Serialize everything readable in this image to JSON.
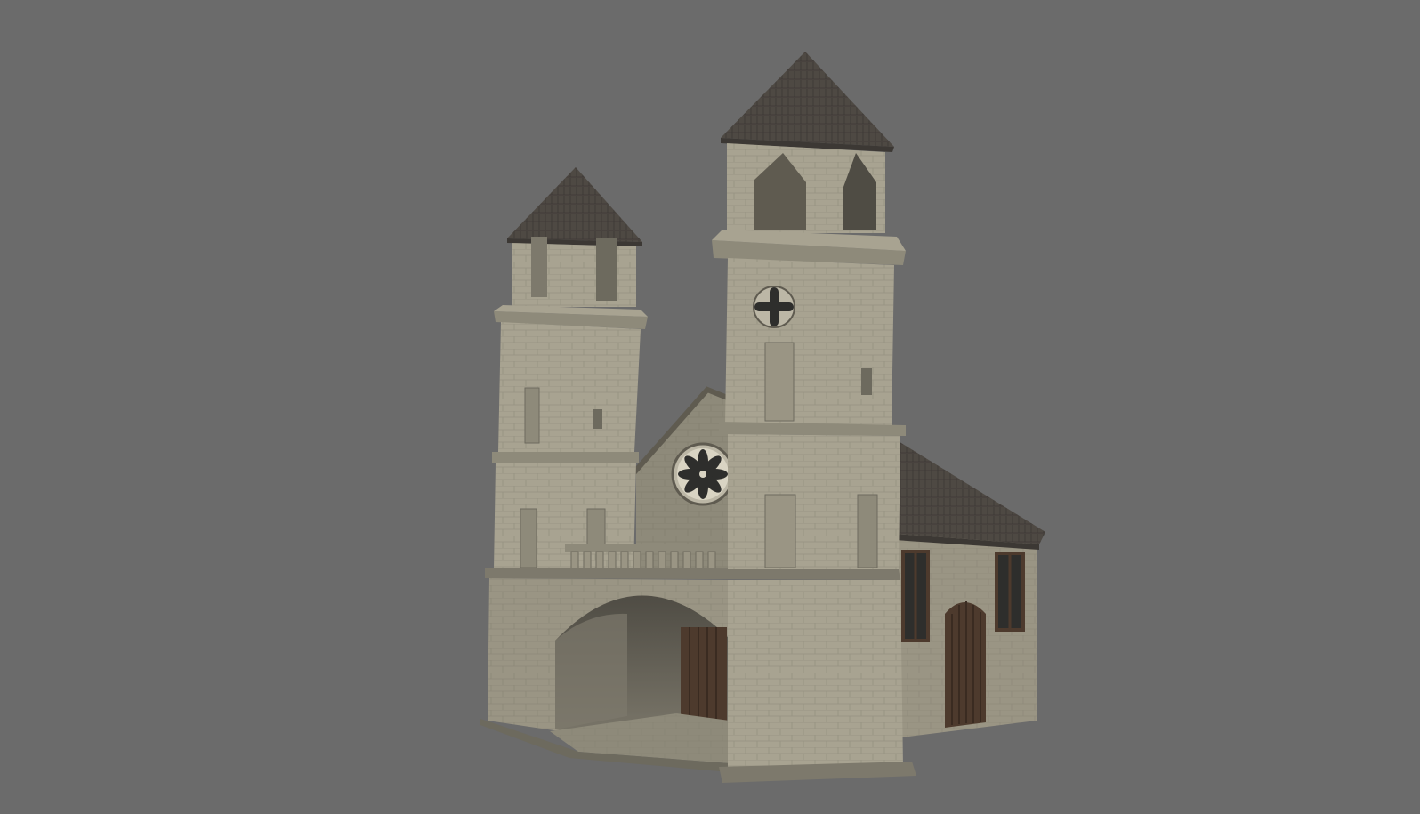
{
  "viewport": {
    "background_color": "#6b6b6b"
  },
  "model": {
    "subject": "church-3d-model",
    "colors": {
      "stone_light": "#a8a391",
      "stone_mid": "#8e8a7a",
      "stone_dark": "#6d6a5e",
      "roof": "#4e4943",
      "roof_dark": "#3c3834",
      "wood": "#4d3a2d",
      "window_dark": "#2e2e2c"
    },
    "ornaments": [
      "cross-window-icon",
      "rose-window-icon"
    ]
  }
}
